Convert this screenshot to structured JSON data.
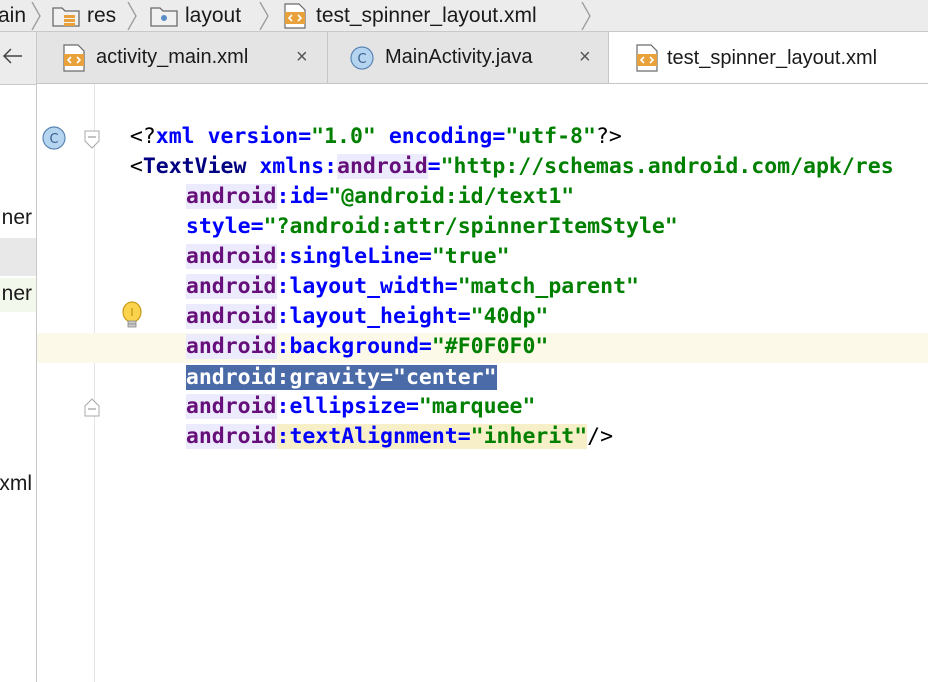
{
  "breadcrumb": {
    "items": [
      "ain",
      "res",
      "layout",
      "test_spinner_layout.xml"
    ]
  },
  "left_panel": {
    "items": [
      "ner",
      "",
      "ner",
      "xml"
    ]
  },
  "tabs": [
    {
      "label": "activity_main.xml",
      "icon": "xml-file-icon",
      "close": "×"
    },
    {
      "label": "MainActivity.java",
      "icon": "java-class-icon",
      "close": "×"
    },
    {
      "label": "test_spinner_layout.xml",
      "icon": "xml-file-icon",
      "active": true
    }
  ],
  "code": {
    "l1": {
      "a": "<?",
      "b": "xml",
      "c": " version",
      "d": "=",
      "e": "\"1.0\"",
      "f": " encoding",
      "g": "=",
      "h": "\"utf-8\"",
      "i": "?>"
    },
    "l2": {
      "a": "<",
      "b": "TextView",
      "c": " xmlns",
      "d": ":",
      "e": "android",
      "f": "=",
      "g": "\"http://schemas.android.com/apk/res"
    },
    "l3": {
      "ns": "android",
      "attr": ":id",
      "eq": "=",
      "val": "\"@android:id/text1\""
    },
    "l4": {
      "attr": "style",
      "eq": "=",
      "val": "\"?android:attr/spinnerItemStyle\""
    },
    "l5": {
      "ns": "android",
      "attr": ":singleLine",
      "eq": "=",
      "val": "\"true\""
    },
    "l6": {
      "ns": "android",
      "attr": ":layout_width",
      "eq": "=",
      "val": "\"match_parent\""
    },
    "l7": {
      "ns": "android",
      "attr": ":layout_height",
      "eq": "=",
      "val": "\"40dp\""
    },
    "l8": {
      "ns": "android",
      "attr": ":background",
      "eq": "=",
      "val": "\"#F0F0F0\""
    },
    "l9": {
      "ns": "android",
      "attr": ":gravity",
      "eq": "=",
      "val": "\"center\""
    },
    "l10": {
      "ns": "android",
      "attr": ":ellipsize",
      "eq": "=",
      "val": "\"marquee\""
    },
    "l11": {
      "ns": "android",
      "attr": ":textAlignment",
      "eq": "=",
      "val": "\"inherit\"",
      "end": "/>"
    }
  },
  "gutter": {
    "class_badge": "C"
  },
  "colors": {
    "selection": "#4a6aa8",
    "current_line": "#fdf9e8",
    "ns": "#660e7a",
    "attr": "#0000ff",
    "value": "#008000",
    "tag": "#000080"
  }
}
